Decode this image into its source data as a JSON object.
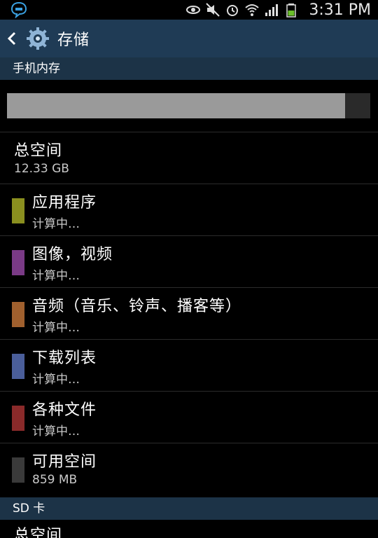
{
  "status_bar": {
    "time": "3:31 PM",
    "icons": [
      "chat-bubble-icon",
      "eye-icon",
      "mute-icon",
      "alarm-icon",
      "wifi-icon",
      "signal-icon",
      "battery-icon"
    ],
    "accent": "#3aa0e0"
  },
  "action_bar": {
    "title": "存储",
    "background": "#1f3b55"
  },
  "internal": {
    "header": "手机内存",
    "used_fraction": 0.93,
    "bar_used_color": "#9a9a9a",
    "bar_free_color": "#2a2a2a",
    "total_label": "总空间",
    "total_value": "12.33 GB",
    "items": [
      {
        "label": "应用程序",
        "value": "计算中…",
        "color": "#8a8f1f"
      },
      {
        "label": "图像，视频",
        "value": "计算中…",
        "color": "#7a3a86"
      },
      {
        "label": "音频（音乐、铃声、播客等）",
        "value": "计算中…",
        "color": "#a0602e"
      },
      {
        "label": "下载列表",
        "value": "计算中…",
        "color": "#4a5e9a"
      },
      {
        "label": "各种文件",
        "value": "计算中…",
        "color": "#8a2a2a"
      },
      {
        "label": "可用空间",
        "value": "859 MB",
        "color": "#3a3a3a"
      }
    ]
  },
  "sd": {
    "header": "SD 卡",
    "total_label": "总空间"
  }
}
